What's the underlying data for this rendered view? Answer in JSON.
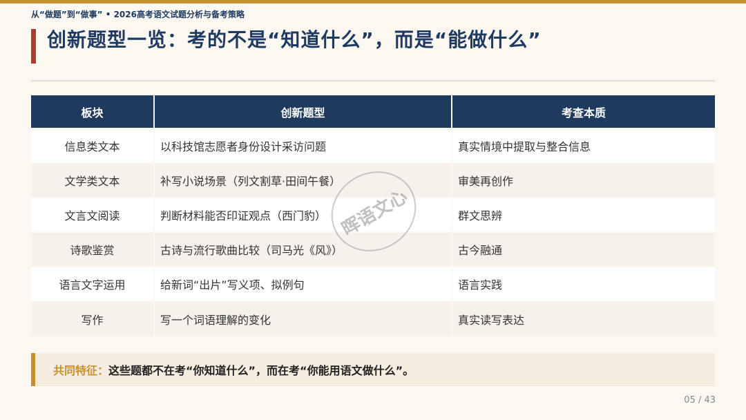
{
  "header": {
    "breadcrumb": "从“做题”到“做事” • 2026高考语文试题分析与备考策略"
  },
  "slide": {
    "title": "创新题型一览：考的不是“知道什么”，而是“能做什么”"
  },
  "table": {
    "headers": [
      "板块",
      "创新题型",
      "考查本质"
    ],
    "rows": [
      [
        "信息类文本",
        "以科技馆志愿者身份设计采访问题",
        "真实情境中提取与整合信息"
      ],
      [
        "文学类文本",
        "补写小说场景（列文割草·田间午餐）",
        "审美再创作"
      ],
      [
        "文言文阅读",
        "判断材料能否印证观点（西门豹）",
        "群文思辨"
      ],
      [
        "诗歌鉴赏",
        "古诗与流行歌曲比较（司马光《风》）",
        "古今融通"
      ],
      [
        "语言文字运用",
        "给新词“出片”写义项、拟例句",
        "语言实践"
      ],
      [
        "写作",
        "写一个词语理解的变化",
        "真实读写表达"
      ]
    ]
  },
  "watermark": {
    "text": "晖语文心"
  },
  "callout": {
    "label": "共同特征：",
    "text": "这些题都不在考“你知道什么”，而在考“你能用语文做什么”。"
  },
  "page": {
    "number": "05 / 43"
  },
  "colors": {
    "navy": "#1e3a5f",
    "gold": "#c8902e",
    "red": "#b23a2c",
    "background": "#fbf8f2"
  }
}
